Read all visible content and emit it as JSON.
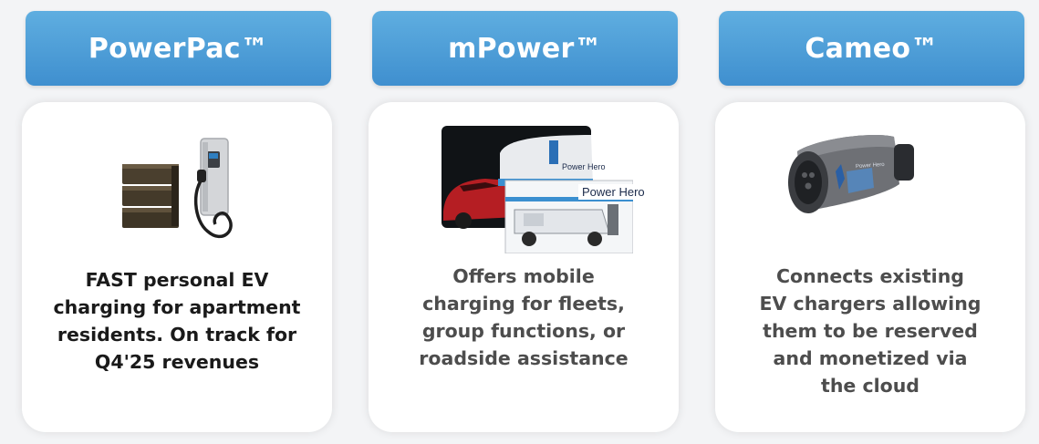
{
  "products": [
    {
      "name": "PowerPac™",
      "icon": "powerpac-charger-icon",
      "description_lines": [
        "FAST personal EV",
        "charging for apartment",
        "residents. On track for",
        "Q4'25 revenues"
      ]
    },
    {
      "name": "mPower™",
      "icon": "mobile-charging-van-icon",
      "image_labels": [
        "Power Hero",
        "Power Hero"
      ],
      "description_lines": [
        "Offers mobile",
        "charging for fleets,",
        "group functions, or",
        "roadside assistance"
      ]
    },
    {
      "name": "Cameo™",
      "icon": "cameo-connector-icon",
      "image_label": "Power Hero",
      "description_lines": [
        "Connects existing",
        "EV chargers allowing",
        "them to be reserved",
        "and monetized via",
        "the cloud"
      ]
    }
  ],
  "colors": {
    "header_top": "#5faee0",
    "header_bottom": "#3f8fcf",
    "card_bg": "#ffffff",
    "page_bg": "#f3f4f6"
  }
}
